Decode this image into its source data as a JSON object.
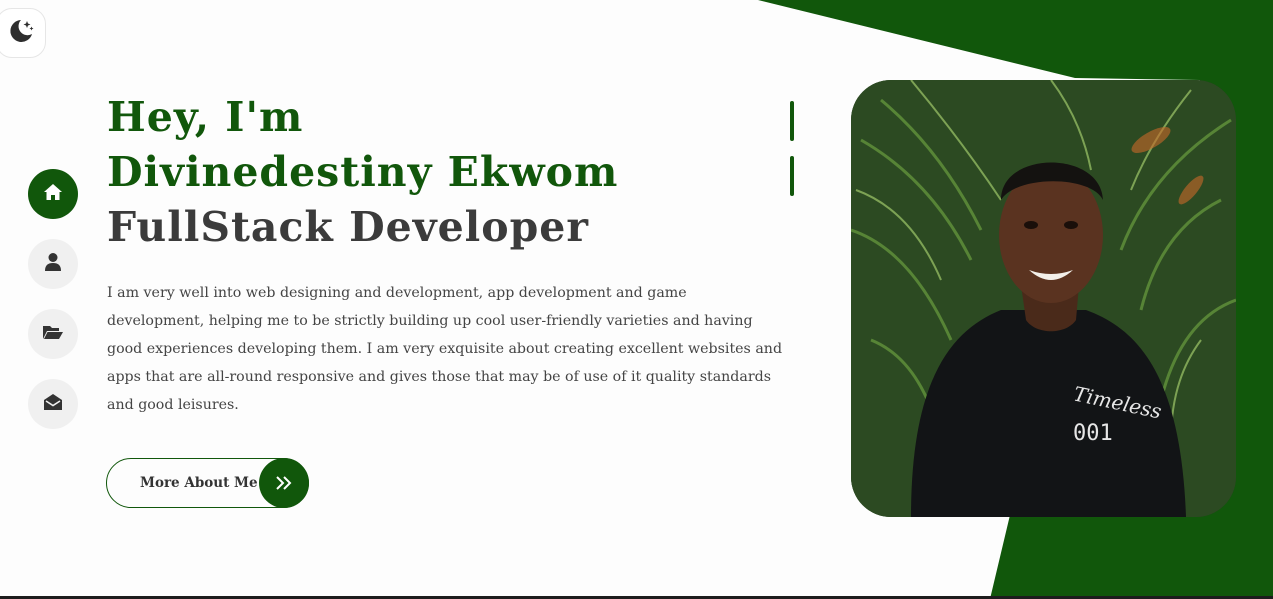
{
  "theme_toggle": {
    "icon": "moon-stars-icon"
  },
  "side_nav": {
    "items": [
      {
        "name": "home",
        "icon": "home-icon",
        "active": true
      },
      {
        "name": "about",
        "icon": "user-icon",
        "active": false
      },
      {
        "name": "portfolio",
        "icon": "folder-open-icon",
        "active": false
      },
      {
        "name": "contact",
        "icon": "envelope-open-icon",
        "active": false
      }
    ]
  },
  "hero": {
    "greeting": "Hey, I'm",
    "name": "Divinedestiny Ekwom",
    "role": "FullStack Developer",
    "bio": "I am very well into web designing and development, app development and game development, helping me to be strictly building up cool user-friendly varieties and having good experiences developing them. I am very exquisite about creating excellent websites and apps that are all-round responsive and gives those that may be of use of it quality standards and good leisures.",
    "cta_label": "More About Me",
    "cta_icon": "double-chevron-right-icon"
  },
  "profile_photo": {
    "shirt_text_line1": "Timeless",
    "shirt_text_line2": "001"
  },
  "colors": {
    "accent": "#11570b",
    "text_dark": "#3b3b3b",
    "text_body": "#444444",
    "nav_bg": "#f0f0f0",
    "page_bg": "#fdfdfd"
  }
}
